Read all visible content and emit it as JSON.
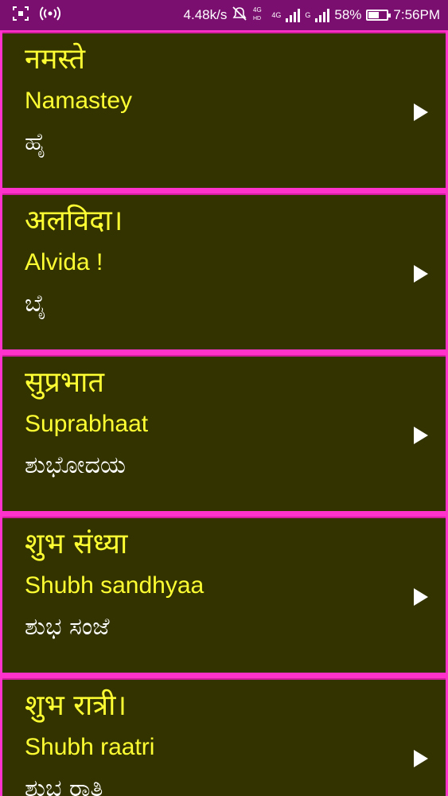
{
  "status_bar": {
    "speed": "4.48k/s",
    "network1": "4G",
    "network2": "G",
    "battery": "58%",
    "battery_level": 0.58,
    "time": "7:56PM",
    "icons": [
      "screenshot-icon",
      "hotspot-icon",
      "mute-icon",
      "volte-icon",
      "signal-icon",
      "battery-icon"
    ]
  },
  "phrases": [
    {
      "hindi": "नमस्ते",
      "translit": "Namastey",
      "kannada": "ಹೈ"
    },
    {
      "hindi": "अलविदा।",
      "translit": "Alvida !",
      "kannada": "ಬೈ"
    },
    {
      "hindi": "सुप्रभात",
      "translit": "Suprabhaat",
      "kannada": "ಶುಭೋದಯ"
    },
    {
      "hindi": "शुभ संध्या",
      "translit": "Shubh sandhyaa",
      "kannada": "ಶುಭ ಸಂಜೆ"
    },
    {
      "hindi": "शुभ रात्री।",
      "translit": "Shubh raatri",
      "kannada": "ಶುಭ ರಾತ್ರಿ"
    }
  ],
  "colors": {
    "status_bar": "#7a0f70",
    "card_bg": "#333300",
    "border": "#ff33cc",
    "primary_text": "#ffff33",
    "secondary_text": "#ffffff"
  }
}
